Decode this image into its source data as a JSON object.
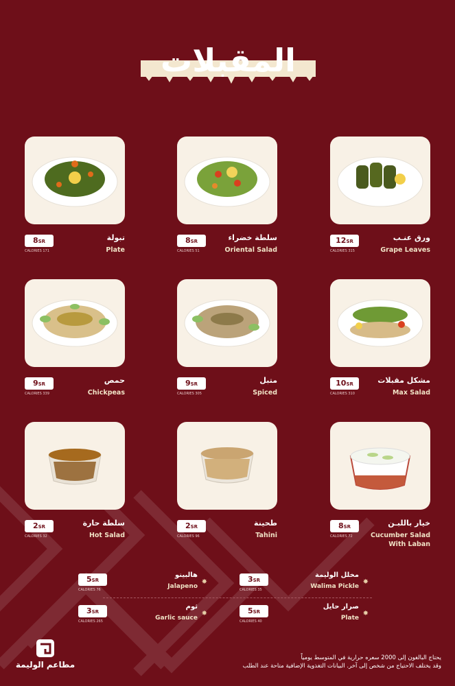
{
  "title": "المقبلات",
  "currency": "SR",
  "items": [
    {
      "name_ar": "تبولة",
      "name_en": "Plate",
      "price": "8",
      "calories": "CALORIES 171"
    },
    {
      "name_ar": "سلطة خضراء",
      "name_en": "Oriental Salad",
      "price": "8",
      "calories": "CALORIES 51"
    },
    {
      "name_ar": "ورق عنـب",
      "name_en": "Grape Leaves",
      "price": "12",
      "calories": "CALORIES 315"
    },
    {
      "name_ar": "حمص",
      "name_en": "Chickpeas",
      "price": "9",
      "calories": "CALORIES 339"
    },
    {
      "name_ar": "متبل",
      "name_en": "Spiced",
      "price": "9",
      "calories": "CALORIES 305"
    },
    {
      "name_ar": "مشكل مقبلات",
      "name_en": "Max Salad",
      "price": "10",
      "calories": "CALORIES 310"
    },
    {
      "name_ar": "سلطة حارة",
      "name_en": "Hot Salad",
      "price": "2",
      "calories": "CALORIES 32"
    },
    {
      "name_ar": "طحينة",
      "name_en": "Tahini",
      "price": "2",
      "calories": "CALORIES 96"
    },
    {
      "name_ar": "خيار باللبـن",
      "name_en": "Cucumber Salad With Laban",
      "price": "8",
      "calories": "CALORIES 72"
    }
  ],
  "extras": [
    {
      "name_ar": "هالبينو",
      "name_en": "Jalapeno",
      "price": "5",
      "calories": "CALORIES 76"
    },
    {
      "name_ar": "مخلل الوليمة",
      "name_en": "Walima Pickle",
      "price": "3",
      "calories": "CALORIES 35"
    },
    {
      "name_ar": "ثوم",
      "name_en": "Garlic sauce",
      "price": "3",
      "calories": "CALORIES 265"
    },
    {
      "name_ar": "صرار حايل",
      "name_en": "Plate",
      "price": "5",
      "calories": "CALORIES 40"
    }
  ],
  "logo": {
    "text": "مطاعم الوليمة"
  },
  "footnote": {
    "line1": "يحتاج البالغون إلى 2000 سعره حرارية في المتوسط يومياً",
    "line2": "وقد يختلف الاحتياج من شخص إلى آخر. البيانات التغذوية الإضافية متاحة عند الطلب"
  },
  "colors": {
    "background": "#6e0f19",
    "card": "#f8f1e6",
    "accent": "#f1e3c6"
  }
}
